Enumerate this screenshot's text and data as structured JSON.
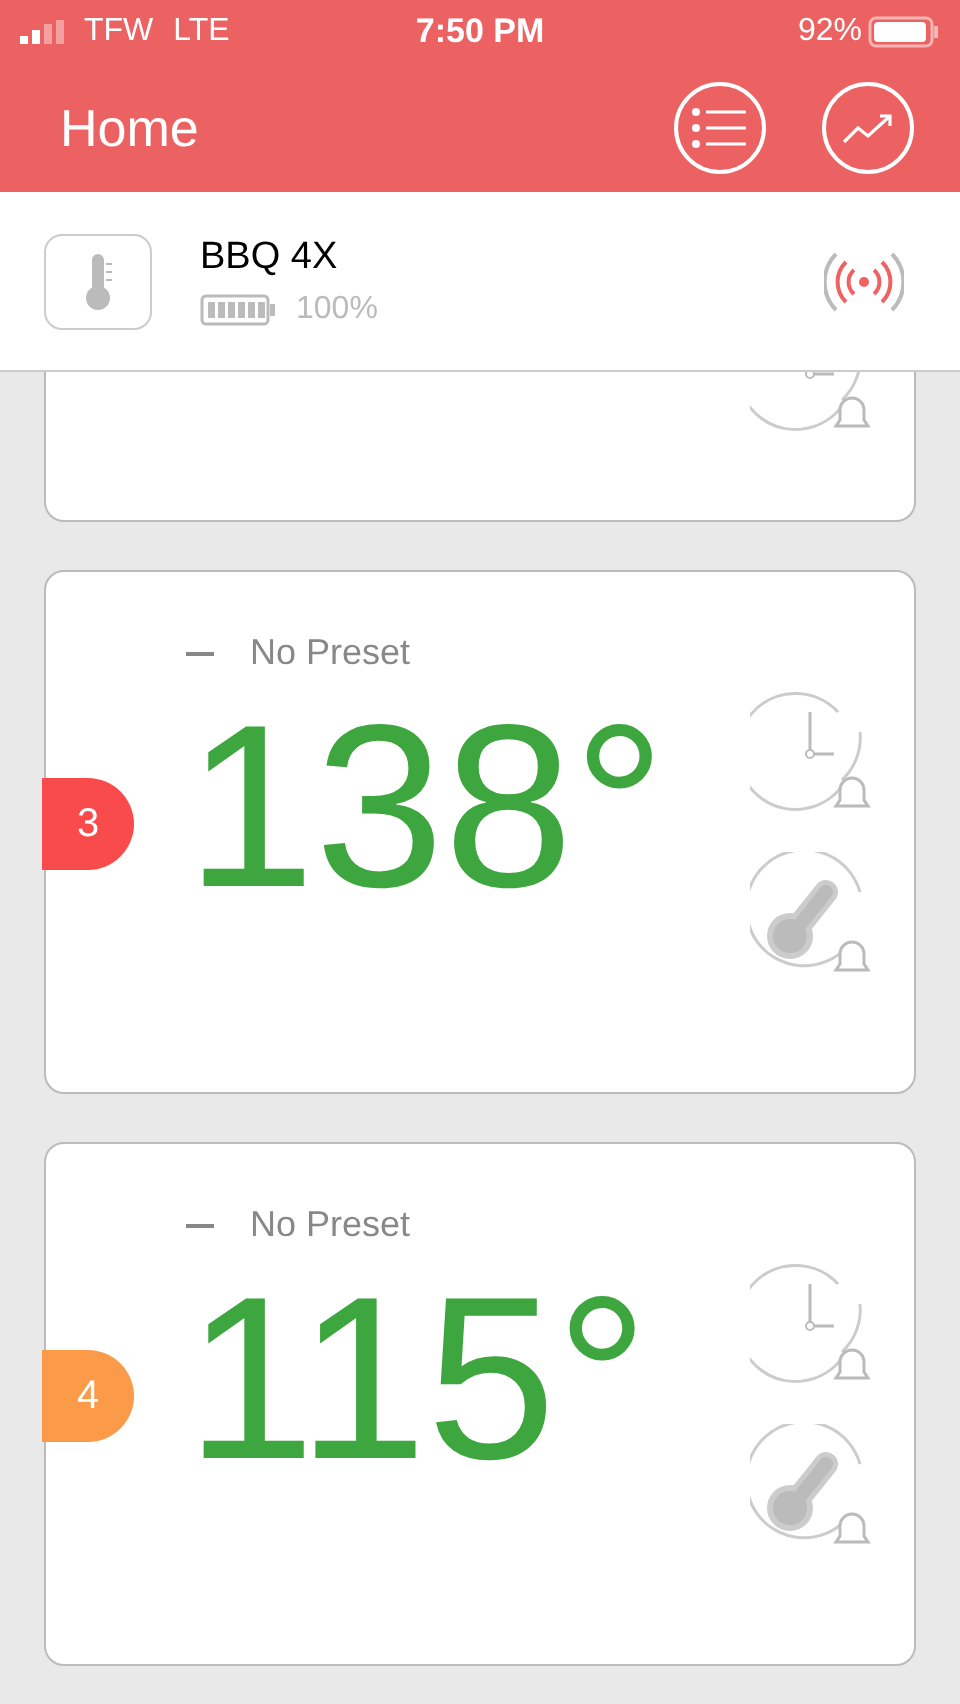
{
  "status_bar": {
    "carrier": "TFW",
    "network": "LTE",
    "time": "7:50 PM",
    "battery": "92%"
  },
  "nav": {
    "title": "Home"
  },
  "device": {
    "name": "BBQ 4X",
    "battery": "100%"
  },
  "probes": [
    {
      "kind": "partial"
    },
    {
      "kind": "full",
      "number": "3",
      "color": "#f94b4b",
      "preset": "No Preset",
      "temperature": "138°"
    },
    {
      "kind": "full",
      "number": "4",
      "color": "#fb9a48",
      "preset": "No Preset",
      "temperature": "115°"
    }
  ]
}
